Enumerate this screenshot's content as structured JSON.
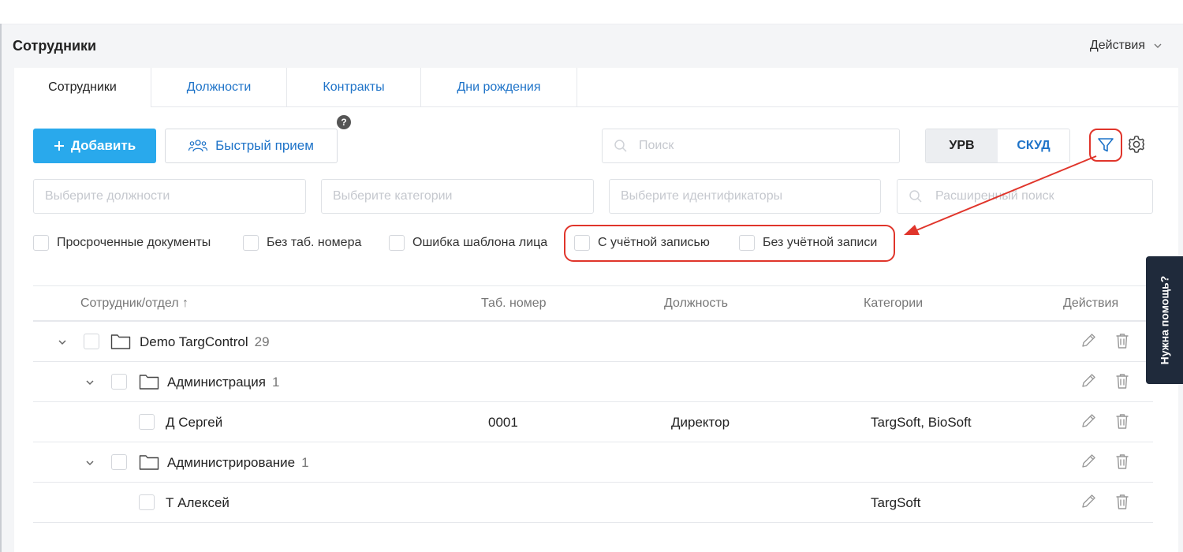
{
  "header": {
    "title": "Сотрудники",
    "actions_label": "Действия"
  },
  "tabs": [
    {
      "label": "Сотрудники",
      "active": true
    },
    {
      "label": "Должности",
      "active": false
    },
    {
      "label": "Контракты",
      "active": false
    },
    {
      "label": "Дни рождения",
      "active": false
    }
  ],
  "toolbar": {
    "add_label": "Добавить",
    "quick_hire_label": "Быстрый прием",
    "help_badge": "?",
    "search_placeholder": "Поиск",
    "mode_options": [
      "УРВ",
      "СКУД"
    ],
    "mode_selected": "УРВ"
  },
  "filters": {
    "positions_placeholder": "Выберите должности",
    "categories_placeholder": "Выберите категории",
    "identifiers_placeholder": "Выберите идентификаторы",
    "advanced_search_placeholder": "Расширенный поиск",
    "checkboxes": [
      {
        "label": "Просроченные документы",
        "checked": false
      },
      {
        "label": "Без таб. номера",
        "checked": false
      },
      {
        "label": "Ошибка шаблона лица",
        "checked": false
      },
      {
        "label": "С учётной записью",
        "checked": false
      },
      {
        "label": "Без учётной записи",
        "checked": false
      }
    ]
  },
  "table": {
    "columns": [
      "Сотрудник/отдел ↑",
      "Таб. номер",
      "Должность",
      "Категории",
      "Действия"
    ],
    "rows": [
      {
        "type": "department",
        "name": "Demo TargControl",
        "count": "29",
        "level": 0
      },
      {
        "type": "department",
        "name": "Администрация",
        "count": "1",
        "level": 1
      },
      {
        "type": "employee",
        "name": "Д Сергей",
        "tab_number": "0001",
        "position": "Директор",
        "categories": "TargSoft, BioSoft",
        "level": 2
      },
      {
        "type": "department",
        "name": "Администрирование",
        "count": "1",
        "level": 1
      },
      {
        "type": "employee",
        "name": "Т Алексей",
        "tab_number": "",
        "position": "",
        "categories": "TargSoft",
        "level": 2
      }
    ]
  },
  "help_tab_label": "Нужна помощь?",
  "colors": {
    "primary": "#29a9ec",
    "link": "#1e73c8",
    "highlight": "#e0352b",
    "help_tab": "#1f2a3b"
  }
}
